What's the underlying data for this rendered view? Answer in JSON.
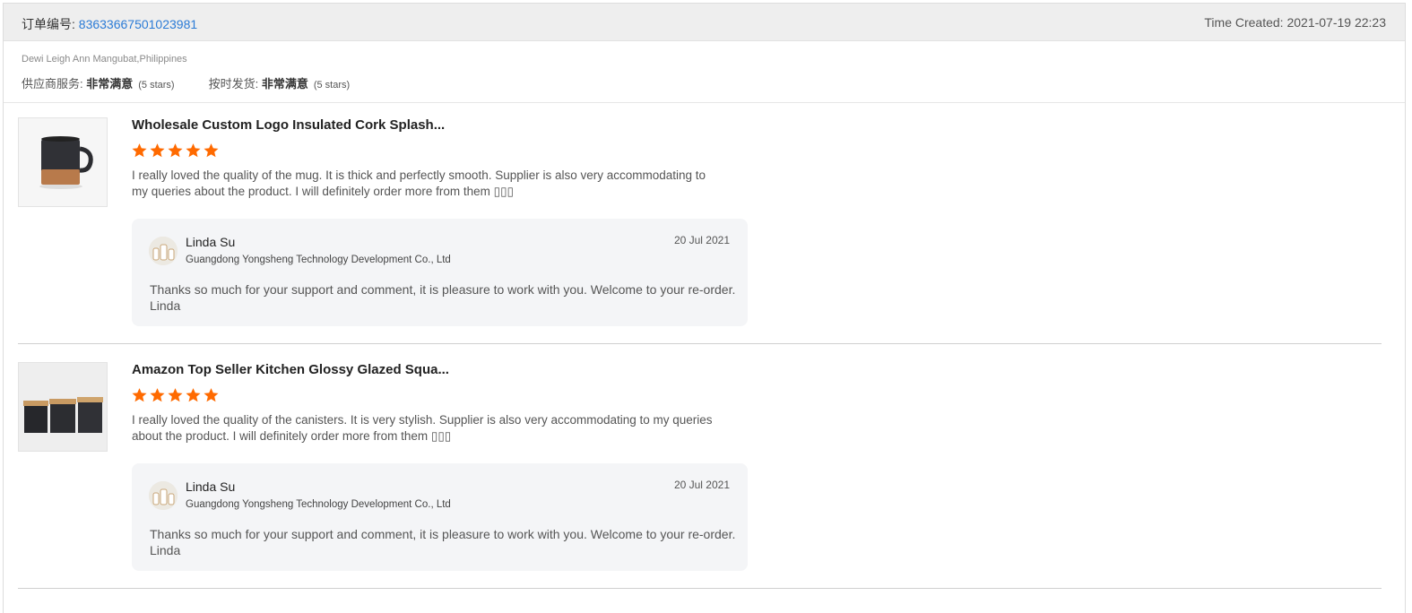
{
  "order": {
    "number_label": "订单编号: ",
    "number": "83633667501023981",
    "time_created": "Time Created: 2021-07-19 22:23"
  },
  "buyer": {
    "name": "Dewi Leigh Ann Mangubat,Philippines",
    "supplier_service_label": "供应商服务: ",
    "supplier_service_value": "非常满意",
    "supplier_service_stars": "(5 stars)",
    "ontime_label": "按时发货: ",
    "ontime_value": "非常满意",
    "ontime_stars": "(5 stars)"
  },
  "products": [
    {
      "title": "Wholesale Custom Logo Insulated Cork Splash...",
      "rating": 5,
      "review": "I really loved the quality of the mug. It is thick and perfectly smooth. Supplier is also very accommodating to my queries about the product. I will definitely order more from them ▯▯▯",
      "reply": {
        "name": "Linda Su",
        "company": "Guangdong Yongsheng Technology Development Co., Ltd",
        "date": "20 Jul 2021",
        "text": "Thanks so much for your support and comment, it is pleasure to work with you. Welcome to your re-order. Linda"
      }
    },
    {
      "title": "Amazon Top Seller Kitchen Glossy Glazed Squa...",
      "rating": 5,
      "review": "I really loved the quality of the canisters. It is very stylish. Supplier is also very accommodating to my queries about the product. I will definitely order more from them ▯▯▯",
      "reply": {
        "name": "Linda Su",
        "company": "Guangdong Yongsheng Technology Development Co., Ltd",
        "date": "20 Jul 2021",
        "text": "Thanks so much for your support and comment, it is pleasure to work with you. Welcome to your re-order. Linda"
      }
    }
  ],
  "colors": {
    "link": "#2b7bd6",
    "star": "#ff6a00",
    "reply_bg": "#f4f5f7",
    "header_bg": "#eeeeee"
  },
  "icons": {
    "star": "star-icon",
    "mug": "mug-product-image",
    "canisters": "canisters-product-image",
    "avatar": "supplier-avatar"
  }
}
